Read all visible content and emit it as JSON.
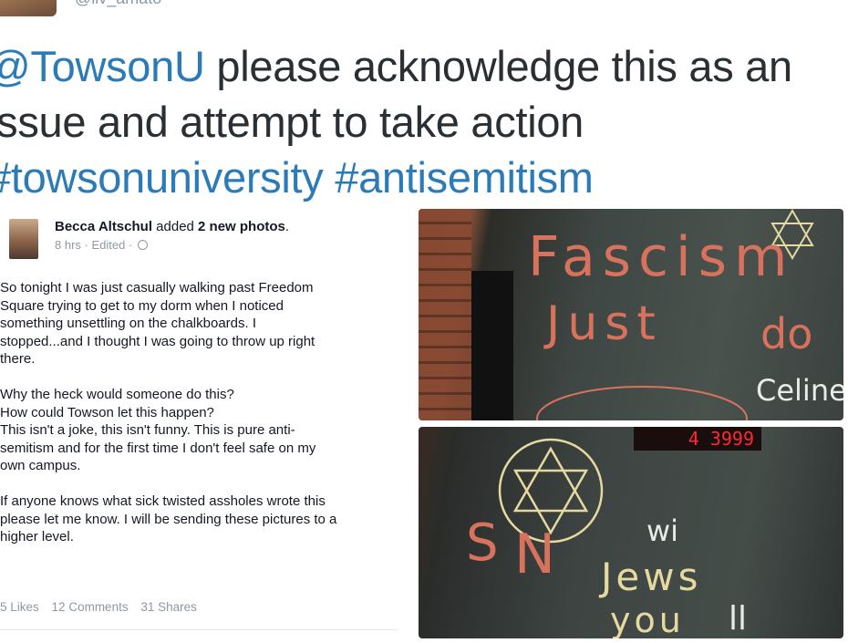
{
  "tweet": {
    "handle": "@liv_amato",
    "text_line1_mention": "@TowsonU",
    "text_line1_rest": " please acknowledge this as an",
    "text_line2": "issue and attempt to take action",
    "hashtag1": "#towsonuniversity",
    "hashtag2": "#antisemitism"
  },
  "fb_post": {
    "author": "Becca Altschul",
    "action_prefix": " added ",
    "action_bold": "2 new photos",
    "action_suffix": ".",
    "meta": "8 hrs · Edited · ",
    "para1": [
      "So tonight I was just casually walking past Freedom",
      "Square trying to get to my dorm when I noticed",
      "something unsettling on the chalkboards. I",
      "stopped...and I thought I was going to throw up right",
      "there."
    ],
    "para2": [
      "Why the heck would someone do this?",
      "How could Towson let this happen?",
      "This isn't a joke, this isn't funny. This is pure anti-",
      "semitism and for the first time I don't feel safe on my",
      "own campus."
    ],
    "para3": [
      "If anyone knows what sick twisted assholes wrote this",
      "please let me know. I will be sending these pictures to a",
      "higher level."
    ],
    "likes": "5 Likes",
    "comments": "12 Comments",
    "shares": "31 Shares"
  },
  "photos": {
    "photo1_words": [
      "Fascism",
      "Just",
      "do",
      "Celine"
    ],
    "photo2_words": [
      "Jews",
      "you",
      "S",
      "N",
      "wi",
      "ll"
    ],
    "counter": "4 3999"
  },
  "colors": {
    "link": "#2b7bb9",
    "text": "#292f33",
    "fb_meta": "#9197a3"
  }
}
